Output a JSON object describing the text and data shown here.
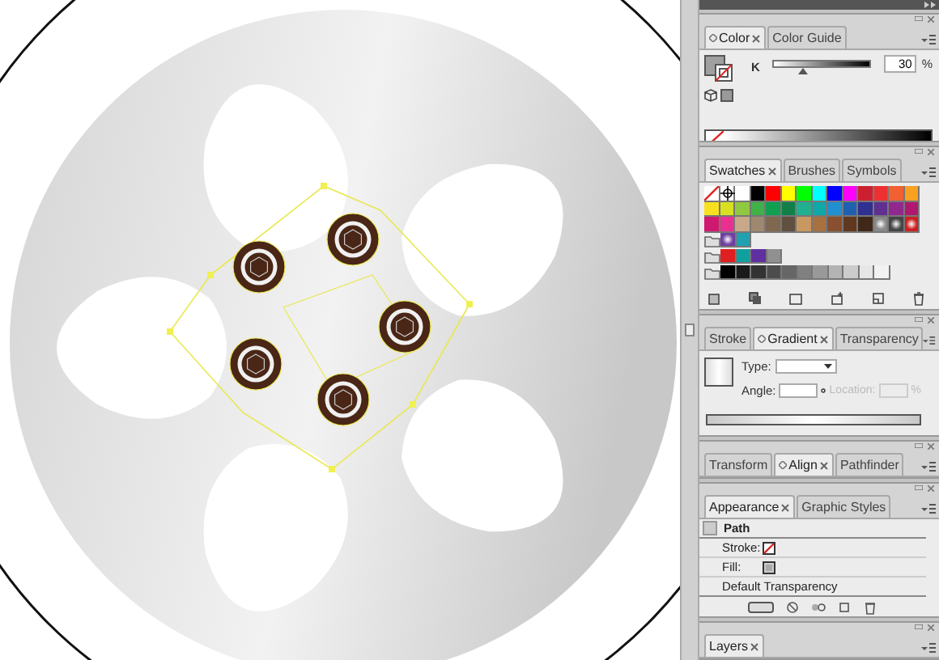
{
  "panels": [
    {
      "kind": "color",
      "tabs": [
        {
          "label": "Color",
          "selected": true
        },
        {
          "label": "Color Guide",
          "selected": false
        }
      ],
      "slider_label": "K",
      "level": 0.3,
      "value": "30",
      "unit": "%"
    },
    {
      "kind": "swatches",
      "tabs": [
        {
          "label": "Swatches",
          "selected": true
        },
        {
          "label": "Brushes",
          "selected": false
        },
        {
          "label": "Symbols",
          "selected": false
        }
      ],
      "swatch_rows": [
        {
          "group": false,
          "swatches": [
            {
              "kind": "none"
            },
            {
              "kind": "registration"
            },
            {
              "kind": "solid",
              "color": "#ffffff"
            },
            {
              "kind": "solid",
              "color": "#000000"
            },
            {
              "kind": "solid",
              "color": "#ff0000"
            },
            {
              "kind": "solid",
              "color": "#ffff00"
            },
            {
              "kind": "solid",
              "color": "#00ff00"
            },
            {
              "kind": "solid",
              "color": "#00ffff"
            },
            {
              "kind": "solid",
              "color": "#0000ff"
            },
            {
              "kind": "solid",
              "color": "#ff00ff"
            },
            {
              "kind": "solid",
              "color": "#cc2030"
            },
            {
              "kind": "solid",
              "color": "#ee3030"
            },
            {
              "kind": "solid",
              "color": "#f06030"
            },
            {
              "kind": "solid",
              "color": "#f8a020"
            }
          ]
        },
        {
          "group": false,
          "swatches": [
            {
              "kind": "solid",
              "color": "#f8e020"
            },
            {
              "kind": "solid",
              "color": "#d8e020"
            },
            {
              "kind": "solid",
              "color": "#90c840"
            },
            {
              "kind": "solid",
              "color": "#40b048"
            },
            {
              "kind": "solid",
              "color": "#10a050"
            },
            {
              "kind": "solid",
              "color": "#108048"
            },
            {
              "kind": "solid",
              "color": "#20b090"
            },
            {
              "kind": "solid",
              "color": "#10a8a8"
            },
            {
              "kind": "solid",
              "color": "#2090d0"
            },
            {
              "kind": "solid",
              "color": "#2060b0"
            },
            {
              "kind": "solid",
              "color": "#303090"
            },
            {
              "kind": "solid",
              "color": "#603090"
            },
            {
              "kind": "solid",
              "color": "#902890"
            },
            {
              "kind": "solid",
              "color": "#b01870"
            }
          ]
        },
        {
          "group": false,
          "swatches": [
            {
              "kind": "solid",
              "color": "#d01870"
            },
            {
              "kind": "solid",
              "color": "#e83090"
            },
            {
              "kind": "solid",
              "color": "#c8a888"
            },
            {
              "kind": "solid",
              "color": "#a08870"
            },
            {
              "kind": "solid",
              "color": "#806850"
            },
            {
              "kind": "solid",
              "color": "#605040"
            },
            {
              "kind": "solid",
              "color": "#c89860"
            },
            {
              "kind": "solid",
              "color": "#a87040"
            },
            {
              "kind": "solid",
              "color": "#885030"
            },
            {
              "kind": "solid",
              "color": "#603820"
            },
            {
              "kind": "solid",
              "color": "#402818"
            },
            {
              "kind": "gradient",
              "color": "#888888"
            },
            {
              "kind": "gradient",
              "color": "#444444"
            },
            {
              "kind": "gradient",
              "color": "#cc2020"
            }
          ]
        },
        {
          "group": true,
          "swatches": [
            {
              "kind": "gradient",
              "color": "#7040a0"
            },
            {
              "kind": "solid",
              "color": "#20a0b0"
            }
          ]
        },
        {
          "group": true,
          "swatches": [
            {
              "kind": "solid",
              "color": "#e02020"
            },
            {
              "kind": "solid",
              "color": "#10a0a0"
            },
            {
              "kind": "solid",
              "color": "#6030a0"
            },
            {
              "kind": "solid",
              "color": "#909090"
            }
          ]
        },
        {
          "group": true,
          "swatches": [
            {
              "kind": "solid",
              "color": "#000000"
            },
            {
              "kind": "solid",
              "color": "#1a1a1a"
            },
            {
              "kind": "solid",
              "color": "#333333"
            },
            {
              "kind": "solid",
              "color": "#4d4d4d"
            },
            {
              "kind": "solid",
              "color": "#666666"
            },
            {
              "kind": "solid",
              "color": "#808080"
            },
            {
              "kind": "solid",
              "color": "#999999"
            },
            {
              "kind": "solid",
              "color": "#b3b3b3"
            },
            {
              "kind": "solid",
              "color": "#cccccc"
            },
            {
              "kind": "solid",
              "color": "#e6e6e6"
            },
            {
              "kind": "solid",
              "color": "#f2f2f2"
            }
          ]
        }
      ]
    },
    {
      "kind": "gradient",
      "tabs": [
        {
          "label": "Stroke",
          "selected": false
        },
        {
          "label": "Gradient",
          "selected": true
        },
        {
          "label": "Transparency",
          "selected": false
        }
      ],
      "type_label": "Type:",
      "angle_label": "Angle:",
      "location_label": "Location:",
      "location_unit": "%"
    },
    {
      "kind": "tabs_only",
      "tabs": [
        {
          "label": "Transform",
          "selected": false
        },
        {
          "label": "Align",
          "selected": true
        },
        {
          "label": "Pathfinder",
          "selected": false
        }
      ]
    },
    {
      "kind": "appearance",
      "tabs": [
        {
          "label": "Appearance",
          "selected": true
        },
        {
          "label": "Graphic Styles",
          "selected": false
        }
      ],
      "title": "Path",
      "rows": [
        {
          "kind": "stroke",
          "label": "Stroke:"
        },
        {
          "kind": "fill",
          "label": "Fill:"
        }
      ],
      "footer": "Default Transparency"
    },
    {
      "kind": "tabs_only",
      "tabs": [
        {
          "label": "Layers",
          "selected": true
        }
      ]
    }
  ]
}
